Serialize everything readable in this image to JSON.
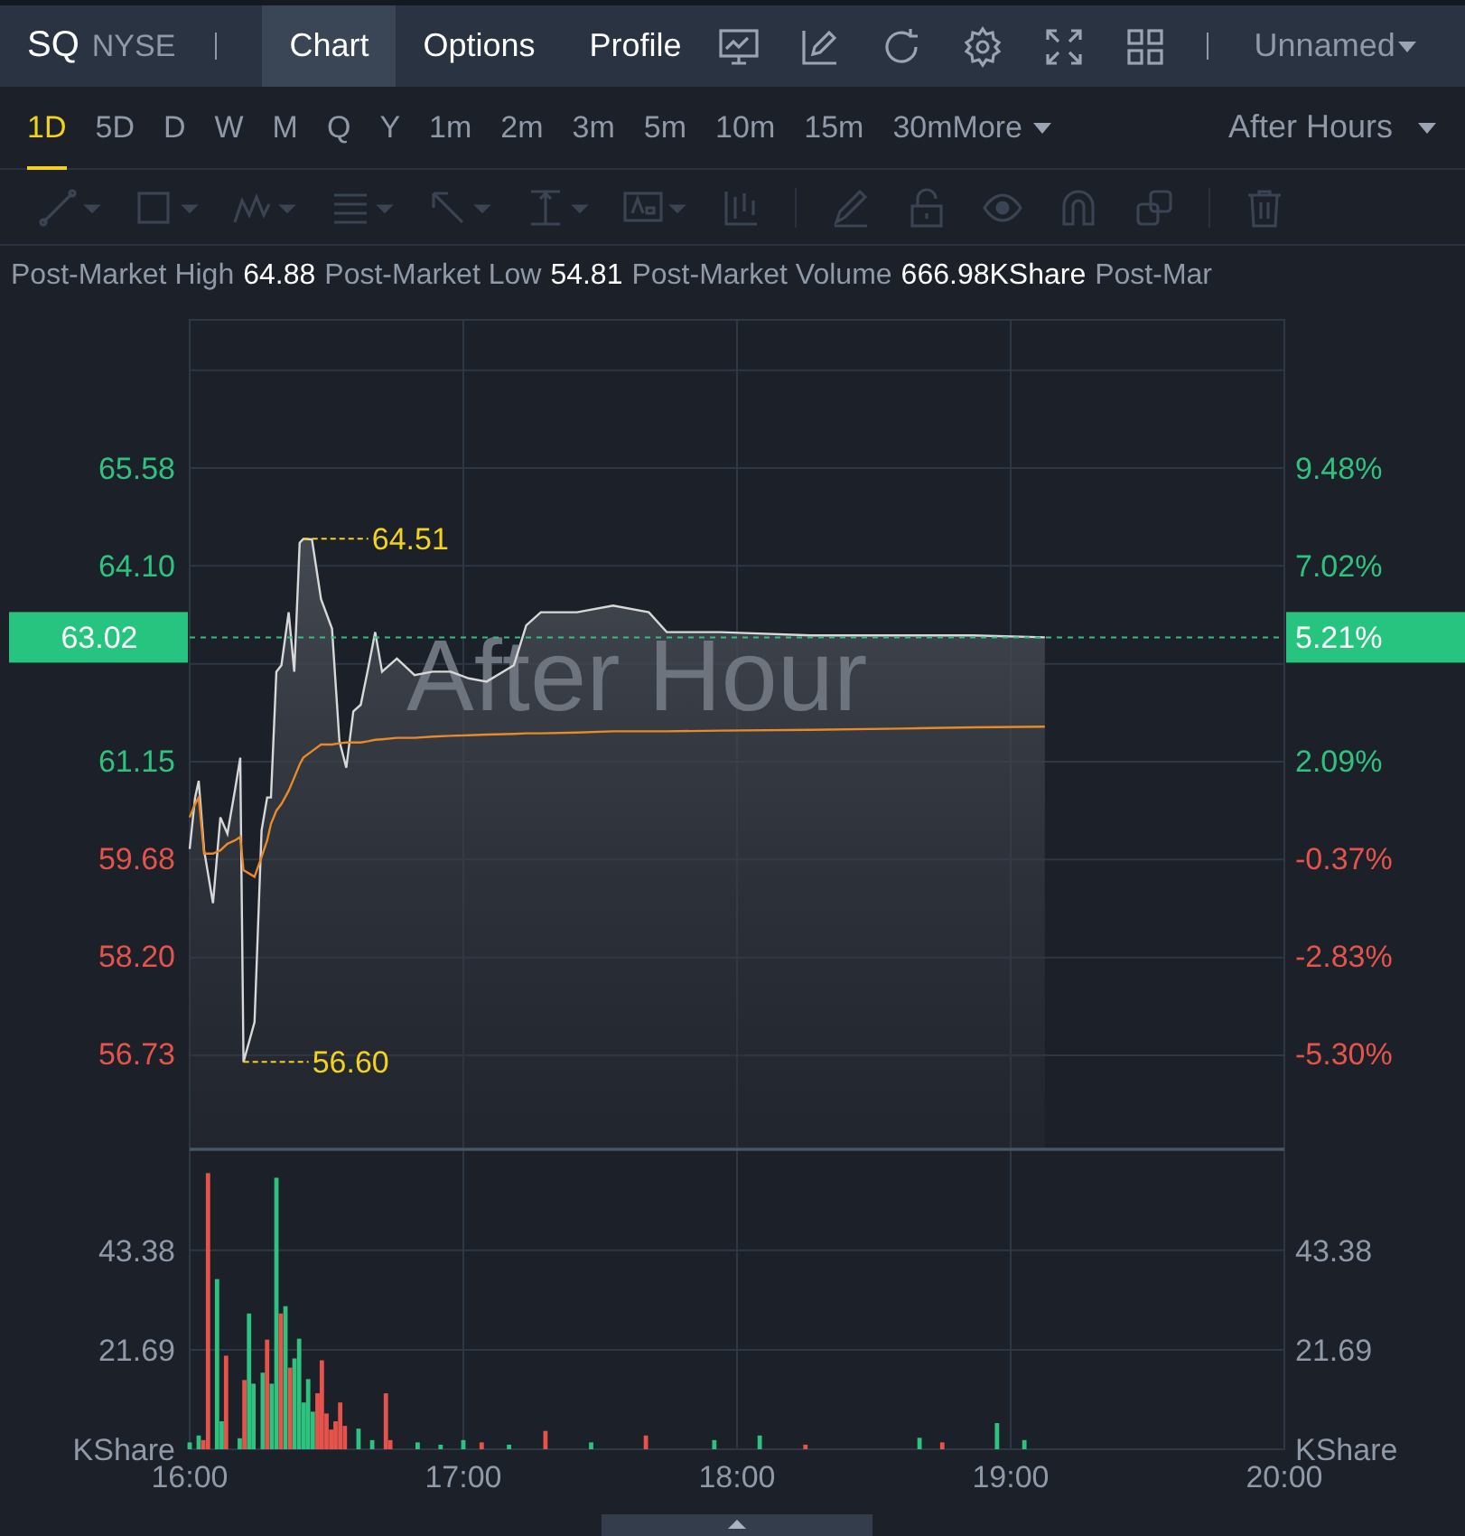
{
  "header": {
    "symbol": "SQ",
    "exchange": "NYSE",
    "tabs": [
      {
        "label": "Chart",
        "selected": true
      },
      {
        "label": "Options",
        "selected": false
      },
      {
        "label": "Profile",
        "selected": false
      }
    ],
    "layout_name": "Unnamed"
  },
  "periods": [
    {
      "label": "1D",
      "selected": true
    },
    {
      "label": "5D",
      "selected": false
    },
    {
      "label": "D",
      "selected": false
    },
    {
      "label": "W",
      "selected": false
    },
    {
      "label": "M",
      "selected": false
    },
    {
      "label": "Q",
      "selected": false
    },
    {
      "label": "Y",
      "selected": false
    },
    {
      "label": "1m",
      "selected": false
    },
    {
      "label": "2m",
      "selected": false
    },
    {
      "label": "3m",
      "selected": false
    },
    {
      "label": "5m",
      "selected": false
    },
    {
      "label": "10m",
      "selected": false
    },
    {
      "label": "15m",
      "selected": false
    },
    {
      "label": "30m",
      "selected": false
    }
  ],
  "more_menu": "More",
  "session": "After Hours",
  "stats": [
    {
      "label": "Post-Market High",
      "value": "64.88"
    },
    {
      "label": "Post-Market Low",
      "value": "54.81"
    },
    {
      "label": "Post-Market Volume",
      "value": "666.98KShare"
    },
    {
      "label": "Post-Mar"
    }
  ],
  "price_chart": {
    "watermark": "After Hour",
    "last": {
      "price": "63.02",
      "change": "5.21%"
    },
    "percent_labels": [
      {
        "label": "9.48%",
        "up": true
      },
      {
        "label": "7.02%",
        "up": true
      },
      {
        "label": "2.09%",
        "up": true
      },
      {
        "label": "-0.37%",
        "up": false
      },
      {
        "label": "-2.83%",
        "up": false
      },
      {
        "label": "-5.30%",
        "up": false
      }
    ],
    "chart_data": {
      "type": "line",
      "ref_lines": [
        {
          "axis": "y",
          "value": 63.02,
          "color": "#2fc27f"
        }
      ],
      "x": [
        16,
        16.02,
        16.033,
        16.053,
        16.085,
        16.112,
        16.138,
        16.165,
        16.185,
        16.197,
        16.237,
        16.263,
        16.283,
        16.297,
        16.317,
        16.335,
        16.362,
        16.382,
        16.402,
        16.415,
        16.447,
        16.48,
        16.52,
        16.547,
        16.572,
        16.598,
        16.625,
        16.652,
        16.678,
        16.703,
        16.757,
        16.822,
        16.888,
        16.953,
        17.02,
        17.085,
        17.185,
        17.23,
        17.283,
        17.415,
        17.547,
        17.678,
        17.743,
        17.94,
        18.27,
        18.598,
        18.862,
        19.125
      ],
      "series": [
        {
          "color": "#d8d8d8",
          "values": [
            59.82,
            60.6,
            60.85,
            59.8,
            59.0,
            60.3,
            60.05,
            60.7,
            61.2,
            56.6,
            57.2,
            60.1,
            60.6,
            60.6,
            62.5,
            62.6,
            63.4,
            62.5,
            64.45,
            64.51,
            64.5,
            63.6,
            63.15,
            61.45,
            61.05,
            61.9,
            62.0,
            62.55,
            63.1,
            62.5,
            62.7,
            62.45,
            62.5,
            62.5,
            62.4,
            62.35,
            62.6,
            63.2,
            63.4,
            63.4,
            63.5,
            63.4,
            63.1,
            63.1,
            63.05,
            63.05,
            63.05,
            63.02
          ]
        },
        {
          "color": "#e8892a",
          "values": [
            60.3,
            60.5,
            60.6,
            59.75,
            59.75,
            59.8,
            59.9,
            59.95,
            60.0,
            59.5,
            59.4,
            59.7,
            59.95,
            60.2,
            60.4,
            60.5,
            60.7,
            60.9,
            61.1,
            61.2,
            61.3,
            61.4,
            61.4,
            61.42,
            61.43,
            61.43,
            61.43,
            61.45,
            61.47,
            61.48,
            61.5,
            61.5,
            61.52,
            61.53,
            61.54,
            61.55,
            61.56,
            61.57,
            61.57,
            61.58,
            61.6,
            61.6,
            61.6,
            61.61,
            61.62,
            61.64,
            61.66,
            61.67
          ]
        }
      ],
      "xlim": [
        16,
        20
      ],
      "ylim": [
        55.28,
        67.82
      ],
      "yticks": [
        {
          "value": 65.58,
          "label": "65.58"
        },
        {
          "value": 64.1,
          "label": "64.10"
        },
        {
          "value": 61.15,
          "label": "61.15"
        },
        {
          "value": 59.68,
          "label": "59.68"
        },
        {
          "value": 58.2,
          "label": "58.20"
        },
        {
          "value": 56.73,
          "label": "56.73"
        }
      ],
      "annotations": [
        {
          "x": 16.415,
          "y": 64.51,
          "text": "64.51"
        },
        {
          "x": 16.197,
          "y": 56.6,
          "text": "56.60"
        }
      ]
    }
  },
  "volume_chart": {
    "right_labels": [
      "43.38",
      "21.69",
      "KShare"
    ],
    "chart_data": {
      "type": "bar",
      "stacked": true,
      "x": [
        16,
        16.033,
        16.05,
        16.067,
        16.1,
        16.117,
        16.133,
        16.183,
        16.2,
        16.217,
        16.233,
        16.267,
        16.283,
        16.3,
        16.317,
        16.333,
        16.35,
        16.367,
        16.383,
        16.4,
        16.417,
        16.433,
        16.45,
        16.467,
        16.483,
        16.5,
        16.517,
        16.533,
        16.55,
        16.567,
        16.617,
        16.667,
        16.717,
        16.733,
        16.833,
        16.917,
        17,
        17.067,
        17.167,
        17.3,
        17.467,
        17.667,
        17.917,
        18.083,
        18.25,
        18.667,
        18.75,
        18.95,
        19.05
      ],
      "series": [
        {
          "color": "#2fc27f",
          "values": [
            1.5,
            3,
            null,
            null,
            37.1,
            6.1,
            null,
            2.4,
            null,
            29.6,
            14.3,
            16.7,
            null,
            14.3,
            59.2,
            null,
            31.2,
            null,
            19.8,
            24.1,
            10.2,
            15.3,
            8.2,
            null,
            null,
            null,
            null,
            null,
            null,
            null,
            4.5,
            2,
            null,
            null,
            1.5,
            1,
            2,
            null,
            1,
            null,
            1.5,
            null,
            2,
            3,
            null,
            2.5,
            null,
            5.7,
            2
          ]
        },
        {
          "color": "#e5534b",
          "values": [
            null,
            null,
            2,
            60.2,
            null,
            null,
            20.4,
            null,
            15.1,
            null,
            null,
            null,
            23.9,
            null,
            null,
            29.6,
            null,
            17.8,
            null,
            null,
            null,
            null,
            null,
            12.2,
            19.4,
            7.8,
            4.3,
            6.1,
            10.2,
            5.1,
            null,
            null,
            12.2,
            2,
            null,
            null,
            null,
            1.5,
            null,
            4,
            null,
            3,
            null,
            null,
            1,
            null,
            1.5,
            null,
            null
          ]
        }
      ],
      "xlim": [
        16,
        20
      ],
      "ylim": [
        0,
        65.4
      ],
      "yticks": [
        {
          "value": 43.38,
          "label": "43.38"
        },
        {
          "value": 21.69,
          "label": "21.69"
        },
        {
          "value": 0,
          "label": "KShare"
        }
      ],
      "xticks": [
        {
          "value": 16,
          "label": "16:00"
        },
        {
          "value": 17,
          "label": "17:00"
        },
        {
          "value": 18,
          "label": "18:00"
        },
        {
          "value": 19,
          "label": "19:00"
        },
        {
          "value": 20,
          "label": "20:00"
        }
      ]
    }
  }
}
